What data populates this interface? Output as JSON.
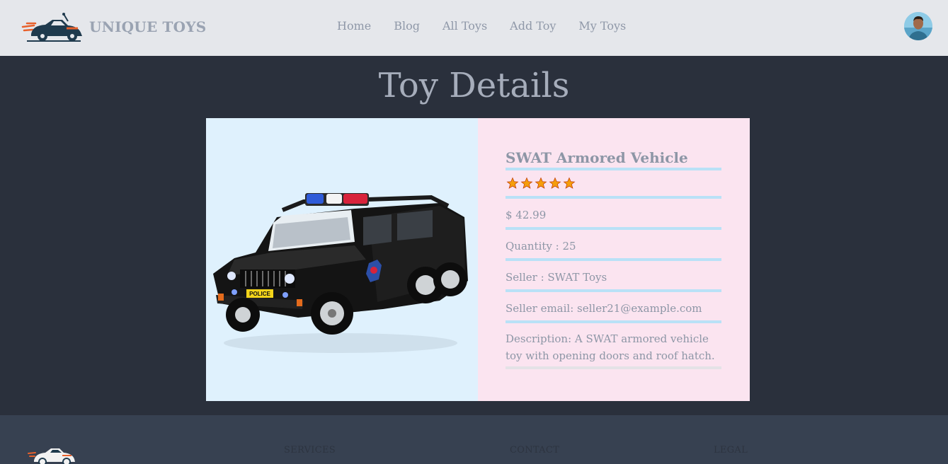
{
  "header": {
    "brand": "UNIQUE TOYS",
    "nav": [
      "Home",
      "Blog",
      "All Toys",
      "Add Toy",
      "My Toys"
    ]
  },
  "page": {
    "title": "Toy Details"
  },
  "toy": {
    "name": "SWAT Armored Vehicle",
    "rating": 5,
    "price": "$ 42.99",
    "quantity": "Quantity : 25",
    "seller": "Seller : SWAT Toys",
    "email": "Seller email: seller21@example.com",
    "description": "Description: A SWAT armored vehicle toy with opening doors and roof hatch.",
    "image_label": "POLICE",
    "image_icon": "police-suv-image"
  },
  "footer": {
    "columns": [
      "SERVICES",
      "CONTACT",
      "LEGAL"
    ]
  },
  "colors": {
    "navbar_bg": "#e5e7eb",
    "main_bg": "#2a303c",
    "footer_bg": "#374151",
    "image_panel_bg": "#dff1fd",
    "info_panel_bg": "#fbe4f0",
    "divider": "#b9e1f7",
    "star": "#f59e0b"
  }
}
